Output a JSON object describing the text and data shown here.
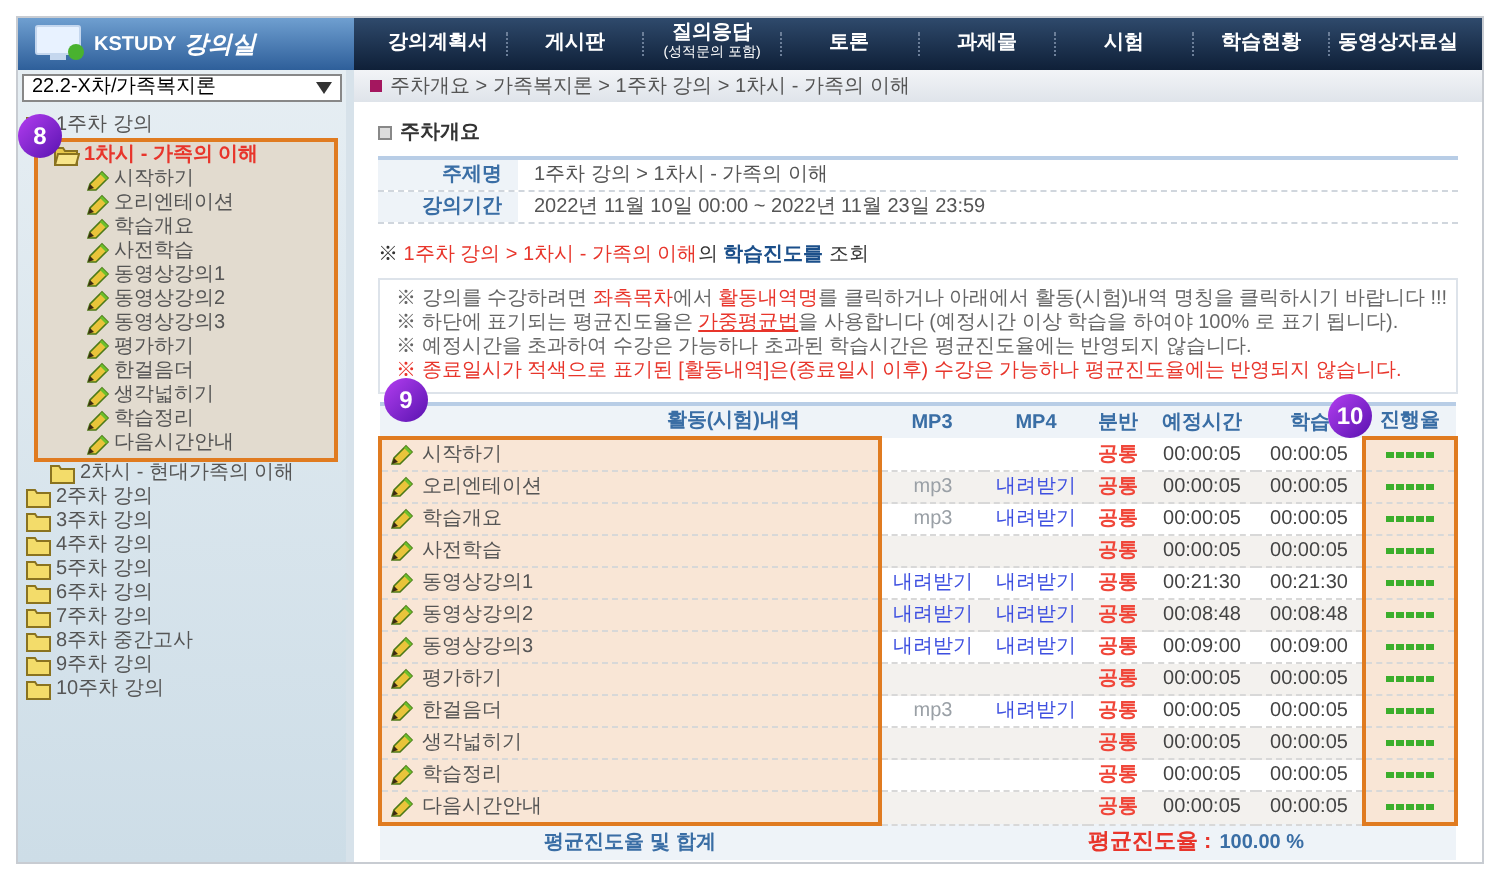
{
  "logo": {
    "brand": "KSTUDY",
    "title": "강의실"
  },
  "nav": [
    {
      "label": "강의계획서"
    },
    {
      "label": "게시판"
    },
    {
      "label": "질의응답",
      "sub": "(성적문의 포함)"
    },
    {
      "label": "토론"
    },
    {
      "label": "과제물"
    },
    {
      "label": "시험"
    },
    {
      "label": "학습현황"
    },
    {
      "label": "동영상자료실"
    }
  ],
  "course_select": {
    "value": "22.2-X차/가족복지론"
  },
  "sidebar": {
    "callout": "8",
    "tree": [
      {
        "kind": "folder",
        "label": "1주차 강의",
        "expanded": true,
        "selected": false,
        "children": [
          {
            "kind": "folder",
            "label": "1차시 - 가족의 이해",
            "expanded": true,
            "selected": true,
            "children": [
              {
                "kind": "activity",
                "label": "시작하기",
                "selected": false
              },
              {
                "kind": "activity",
                "label": "오리엔테이션",
                "selected": false
              },
              {
                "kind": "activity",
                "label": "학습개요",
                "selected": false
              },
              {
                "kind": "activity",
                "label": "사전학습",
                "selected": false
              },
              {
                "kind": "activity",
                "label": "동영상강의1",
                "selected": false
              },
              {
                "kind": "activity",
                "label": "동영상강의2",
                "selected": false
              },
              {
                "kind": "activity",
                "label": "동영상강의3",
                "selected": false
              },
              {
                "kind": "activity",
                "label": "평가하기",
                "selected": false
              },
              {
                "kind": "activity",
                "label": "한걸음더",
                "selected": false
              },
              {
                "kind": "activity",
                "label": "생각넓히기",
                "selected": false
              },
              {
                "kind": "activity",
                "label": "학습정리",
                "selected": false
              },
              {
                "kind": "activity",
                "label": "다음시간안내",
                "selected": false
              }
            ]
          },
          {
            "kind": "folder",
            "label": "2차시 - 현대가족의 이해",
            "expanded": false,
            "selected": false
          }
        ]
      },
      {
        "kind": "folder",
        "label": "2주차 강의",
        "expanded": false,
        "selected": false
      },
      {
        "kind": "folder",
        "label": "3주차 강의",
        "expanded": false,
        "selected": false
      },
      {
        "kind": "folder",
        "label": "4주차 강의",
        "expanded": false,
        "selected": false
      },
      {
        "kind": "folder",
        "label": "5주차 강의",
        "expanded": false,
        "selected": false
      },
      {
        "kind": "folder",
        "label": "6주차 강의",
        "expanded": false,
        "selected": false
      },
      {
        "kind": "folder",
        "label": "7주차 강의",
        "expanded": false,
        "selected": false
      },
      {
        "kind": "folder",
        "label": "8주차 중간고사",
        "expanded": false,
        "selected": false
      },
      {
        "kind": "folder",
        "label": "9주차 강의",
        "expanded": false,
        "selected": false
      },
      {
        "kind": "folder",
        "label": "10주차 강의",
        "expanded": false,
        "selected": false
      }
    ]
  },
  "breadcrumb": "주차개요 > 가족복지론 > 1주차 강의 > 1차시 - 가족의 이해",
  "overview": {
    "title": "주차개요",
    "fields": [
      {
        "label": "주제명",
        "value": "1주차 강의 > 1차시 - 가족의 이해"
      },
      {
        "label": "강의기간",
        "value": "2022년 11월 10일 00:00 ~ 2022년 11월 23일 23:59"
      }
    ]
  },
  "progress_title": [
    {
      "kind": "plain",
      "text": "※ "
    },
    {
      "kind": "red",
      "text": "1주차 강의 > 1차시 - 가족의 이해"
    },
    {
      "kind": "plain",
      "text": "의 "
    },
    {
      "kind": "strong",
      "text": "학습진도를"
    },
    {
      "kind": "plain",
      "text": " 조회"
    }
  ],
  "notices": [
    [
      {
        "kind": "plain",
        "text": "※ 강의를 수강하려면 "
      },
      {
        "kind": "red",
        "text": "좌측목차"
      },
      {
        "kind": "plain",
        "text": "에서 "
      },
      {
        "kind": "red",
        "text": "활동내역명"
      },
      {
        "kind": "plain",
        "text": "를 클릭하거나 아래에서 활동(시험)내역 명칭을 클릭하시기 바랍니다 !!!"
      }
    ],
    [
      {
        "kind": "plain",
        "text": "※ 하단에 표기되는 평균진도율은 "
      },
      {
        "kind": "link",
        "text": "가중평균법"
      },
      {
        "kind": "plain",
        "text": "을 사용합니다 (예정시간 이상 학습을 하여야 100% 로 표기 됩니다)."
      }
    ],
    [
      {
        "kind": "plain",
        "text": "※ 예정시간을 초과하여 수강은 가능하나 초과된 학습시간은 평균진도율에는 반영되지 않습니다."
      }
    ],
    [
      {
        "kind": "red",
        "text": "※ 종료일시가 적색으로 표기된 [활동내역]은(종료일시 이후) 수강은 가능하나 평균진도율에는 반영되지 않습니다."
      }
    ]
  ],
  "table": {
    "activity_callout": "9",
    "progress_callout": "10",
    "columns": [
      "활동(시험)내역",
      "MP3",
      "MP4",
      "분반",
      "예정시간",
      "학습",
      "진행율"
    ],
    "rows": [
      {
        "name": "시작하기",
        "section": "공통",
        "planned": "00:00:05",
        "studied": "00:00:05",
        "level": 1
      },
      {
        "name": "오리엔테이션",
        "mp3": {
          "text": "mp3",
          "disabled": true
        },
        "mp4": {
          "text": "내려받기",
          "disabled": false
        },
        "section": "공통",
        "planned": "00:00:05",
        "studied": "00:00:05",
        "level": 1
      },
      {
        "name": "학습개요",
        "mp3": {
          "text": "mp3",
          "disabled": true
        },
        "mp4": {
          "text": "내려받기",
          "disabled": false
        },
        "section": "공통",
        "planned": "00:00:05",
        "studied": "00:00:05",
        "level": 1
      },
      {
        "name": "사전학습",
        "section": "공통",
        "planned": "00:00:05",
        "studied": "00:00:05",
        "level": 1
      },
      {
        "name": "동영상강의1",
        "mp3": {
          "text": "내려받기",
          "disabled": false
        },
        "mp4": {
          "text": "내려받기",
          "disabled": false
        },
        "section": "공통",
        "planned": "00:21:30",
        "studied": "00:21:30",
        "level": 1
      },
      {
        "name": "동영상강의2",
        "mp3": {
          "text": "내려받기",
          "disabled": false
        },
        "mp4": {
          "text": "내려받기",
          "disabled": false
        },
        "section": "공통",
        "planned": "00:08:48",
        "studied": "00:08:48",
        "level": 1
      },
      {
        "name": "동영상강의3",
        "mp3": {
          "text": "내려받기",
          "disabled": false
        },
        "mp4": {
          "text": "내려받기",
          "disabled": false
        },
        "section": "공통",
        "planned": "00:09:00",
        "studied": "00:09:00",
        "level": 1
      },
      {
        "name": "평가하기",
        "section": "공통",
        "planned": "00:00:05",
        "studied": "00:00:05",
        "level": 1
      },
      {
        "name": "한걸음더",
        "mp3": {
          "text": "mp3",
          "disabled": true
        },
        "mp4": {
          "text": "내려받기",
          "disabled": false
        },
        "section": "공통",
        "planned": "00:00:05",
        "studied": "00:00:05",
        "level": 1
      },
      {
        "name": "생각넓히기",
        "section": "공통",
        "planned": "00:00:05",
        "studied": "00:00:05",
        "level": 1
      },
      {
        "name": "학습정리",
        "section": "공통",
        "planned": "00:00:05",
        "studied": "00:00:05",
        "level": 1
      },
      {
        "name": "다음시간안내",
        "section": "공통",
        "planned": "00:00:05",
        "studied": "00:00:05",
        "level": 1
      }
    ],
    "footer": {
      "label": "평균진도율 및 합계",
      "average_label": "평균진도율 :",
      "average_value": "100.00 %"
    }
  }
}
